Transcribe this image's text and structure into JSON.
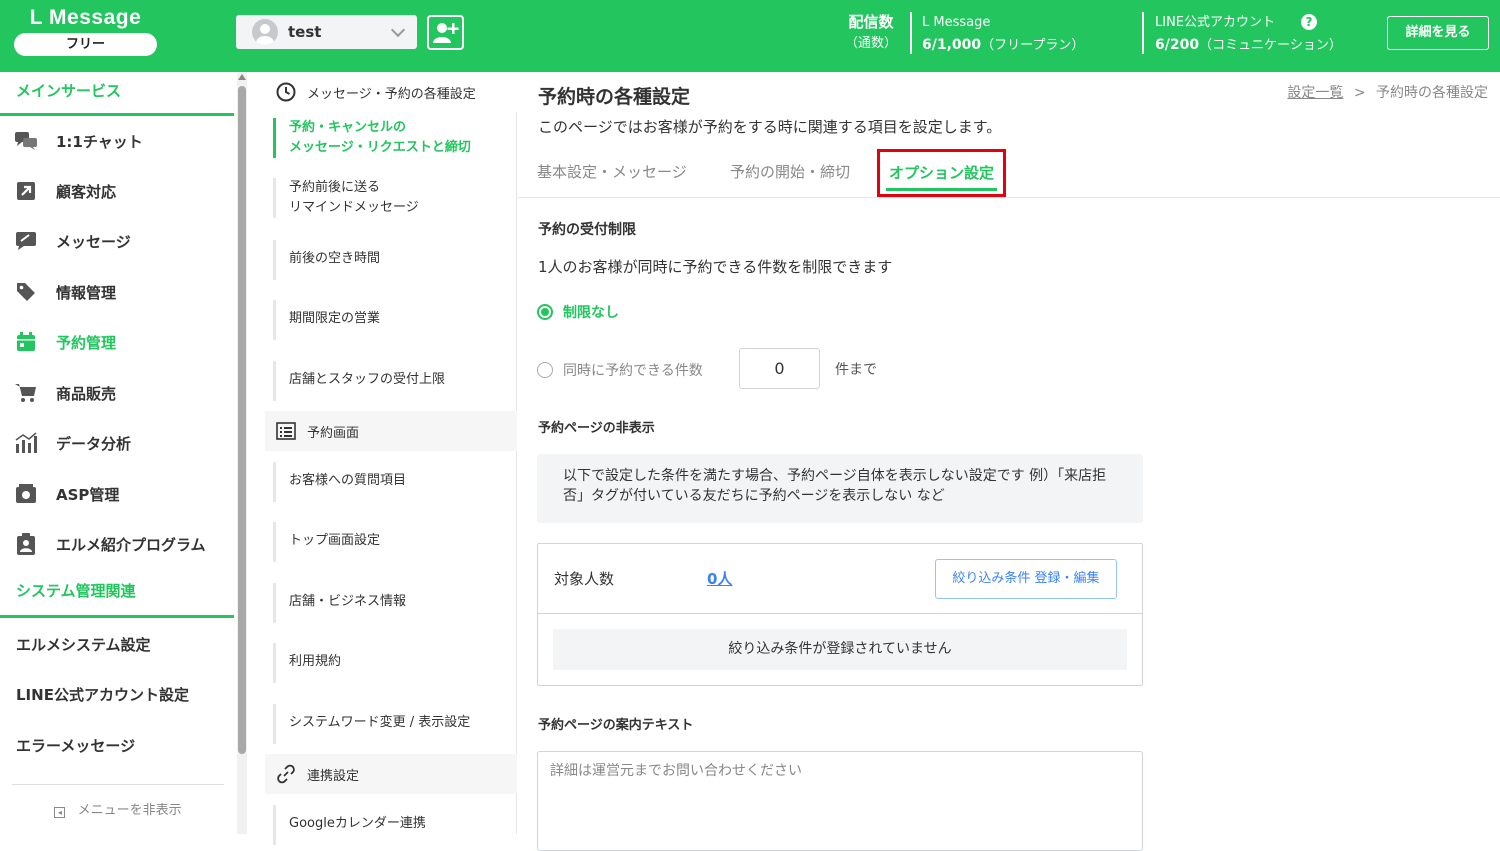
{
  "header": {
    "logo": "L Message",
    "plan_badge": "フリー",
    "account_name": "test",
    "stat1": {
      "label": "配信数",
      "sub": "（通数）",
      "name": "L Message",
      "value": "6/1,000",
      "plan": "（フリープラン）"
    },
    "stat2": {
      "name": "LINE公式アカウント",
      "value": "6/200",
      "plan": "（コミュニケーション）"
    },
    "help_icon": "?",
    "detail_button": "詳細を見る",
    "accent_color": "#22c55e"
  },
  "sidebar": {
    "main_section": "メインサービス",
    "main_items": [
      {
        "label": "1:1チャット",
        "icon": "chat-icon"
      },
      {
        "label": "顧客対応",
        "icon": "arrow-icon"
      },
      {
        "label": "メッセージ",
        "icon": "message-icon"
      },
      {
        "label": "情報管理",
        "icon": "tag-icon"
      },
      {
        "label": "予約管理",
        "icon": "calendar-icon",
        "active": true
      },
      {
        "label": "商品販売",
        "icon": "cart-icon"
      },
      {
        "label": "データ分析",
        "icon": "chart-icon"
      },
      {
        "label": "ASP管理",
        "icon": "asp-icon"
      },
      {
        "label": "エルメ紹介プログラム",
        "icon": "clipboard-icon"
      }
    ],
    "system_section": "システム管理関連",
    "system_items": [
      "エルメシステム設定",
      "LINE公式アカウント設定",
      "エラーメッセージ"
    ],
    "hide_menu": "メニューを非表示"
  },
  "submenu": {
    "head_message": "メッセージ・予約の各種設定",
    "items_group1": [
      {
        "line1": "予約・キャンセルの",
        "line2": "メッセージ・リクエストと締切",
        "active": true
      },
      {
        "line1": "予約前後に送る",
        "line2": "リマインドメッセージ"
      },
      {
        "line1": "前後の空き時間"
      },
      {
        "line1": "期間限定の営業"
      },
      {
        "line1": "店舗とスタッフの受付上限"
      }
    ],
    "head_screen": "予約画面",
    "items_group2": [
      "お客様への質問項目",
      "トップ画面設定",
      "店舗・ビジネス情報",
      "利用規約",
      "システムワード変更 / 表示設定"
    ],
    "head_link": "連携設定",
    "items_group3": [
      "Googleカレンダー連携"
    ]
  },
  "main": {
    "title": "予約時の各種設定",
    "breadcrumb_link": "設定一覧",
    "breadcrumb_sep": ">",
    "breadcrumb_current": "予約時の各種設定",
    "description": "このページではお客様が予約をする時に関連する項目を設定します。",
    "tabs": [
      "基本設定・メッセージ",
      "予約の開始・締切",
      "オプション設定"
    ],
    "limit": {
      "title": "予約の受付制限",
      "desc": "1人のお客様が同時に予約できる件数を制限できます",
      "option_none": "制限なし",
      "option_count": "同時に予約できる件数",
      "count_value": "0",
      "unit": "件まで"
    },
    "hide": {
      "title": "予約ページの非表示",
      "info": "以下で設定した条件を満たす場合、予約ページ自体を表示しない設定です 例）「来店拒否」タグが付いている友だちに予約ページを表示しない など",
      "target_label": "対象人数",
      "target_count": "0人",
      "filter_button": "絞り込み条件 登録・編集",
      "empty_note": "絞り込み条件が登録されていません"
    },
    "guide": {
      "title": "予約ページの案内テキスト",
      "placeholder": "詳細は運営元までお問い合わせください"
    }
  }
}
